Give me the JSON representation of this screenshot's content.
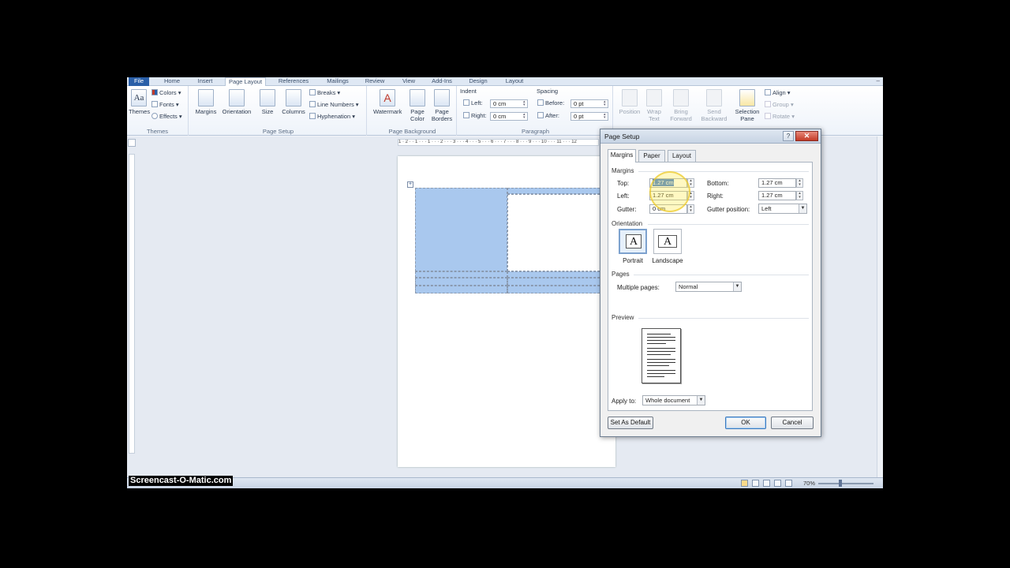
{
  "ribbon_tabs": [
    "File",
    "Home",
    "Insert",
    "Page Layout",
    "References",
    "Mailings",
    "Review",
    "View",
    "Add-Ins",
    "Design",
    "Layout"
  ],
  "window_controls": "–",
  "themes": {
    "themes_label": "Themes",
    "colors": "Colors",
    "fonts": "Fonts",
    "effects": "Effects",
    "group_label": "Themes"
  },
  "page_setup_group": {
    "margins": "Margins",
    "orientation": "Orientation",
    "size": "Size",
    "columns": "Columns",
    "breaks": "Breaks",
    "line_numbers": "Line Numbers",
    "hyphenation": "Hyphenation",
    "group_label": "Page Setup"
  },
  "page_background": {
    "watermark": "Watermark",
    "page_color_1": "Page",
    "page_color_2": "Color",
    "page_borders_1": "Page",
    "page_borders_2": "Borders",
    "group_label": "Page Background"
  },
  "paragraph": {
    "indent": "Indent",
    "left_label": "Left:",
    "left_value": "0 cm",
    "right_label": "Right:",
    "right_value": "0 cm",
    "spacing": "Spacing",
    "before_label": "Before:",
    "before_value": "0 pt",
    "after_label": "After:",
    "after_value": "0 pt",
    "group_label": "Paragraph"
  },
  "arrange": {
    "position": "Position",
    "wrap_text_1": "Wrap",
    "wrap_text_2": "Text",
    "bring_forward_1": "Bring",
    "bring_forward_2": "Forward",
    "send_backward_1": "Send",
    "send_backward_2": "Backward",
    "selection_pane_1": "Selection",
    "selection_pane_2": "Pane",
    "align": "Align",
    "group": "Group",
    "rotate": "Rotate"
  },
  "ruler_text": "1 · 2 · · 1 · · · 1 · · · 2 · · · 3 · · · 4 · · · 5 · · · 6 · · · 7 · · · 8 · · · 9 · · · 10 · · · 11 · · · 12",
  "dialog": {
    "title": "Page Setup",
    "help": "?",
    "close": "✕",
    "tabs": [
      "Margins",
      "Paper",
      "Layout"
    ],
    "margins_section": "Margins",
    "top_label": "Top:",
    "top_value": "1.27 cm",
    "bottom_label": "Bottom:",
    "bottom_value": "1.27 cm",
    "left_label": "Left:",
    "left_value": "1.27 cm",
    "right_label": "Right:",
    "right_value": "1.27 cm",
    "gutter_label": "Gutter:",
    "gutter_value": "0 cm",
    "gutter_position_label": "Gutter position:",
    "gutter_position_value": "Left",
    "orientation_section": "Orientation",
    "portrait": "Portrait",
    "landscape": "Landscape",
    "orientation_glyph": "A",
    "pages_section": "Pages",
    "multiple_pages_label": "Multiple pages:",
    "multiple_pages_value": "Normal",
    "preview_section": "Preview",
    "apply_to_label": "Apply to:",
    "apply_to_value": "Whole document",
    "set_default": "Set As Default",
    "ok": "OK",
    "cancel": "Cancel"
  },
  "status": {
    "zoom": "70%"
  },
  "watermark_text": "Screencast-O-Matic.com"
}
